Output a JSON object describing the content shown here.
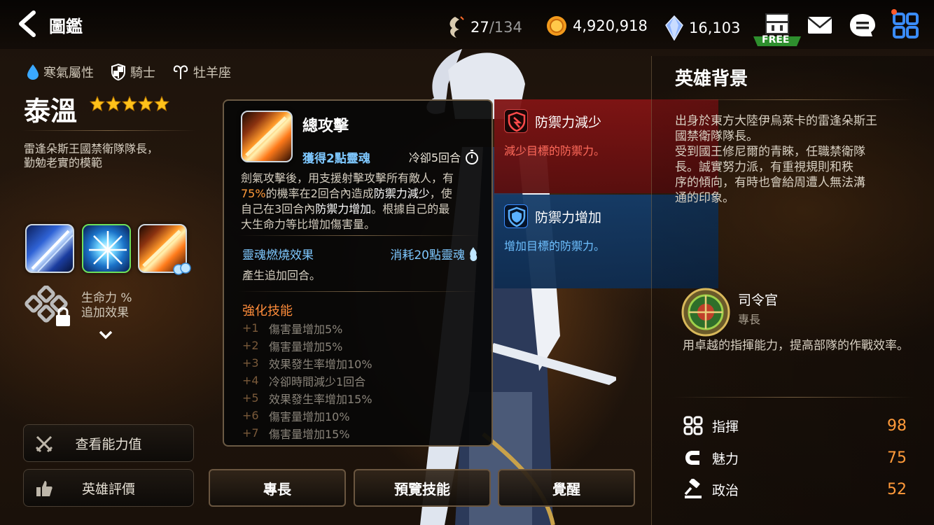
{
  "header": {
    "title": "圖鑑",
    "soul_current": "27",
    "soul_max": "/134",
    "gold": "4,920,918",
    "crystal": "16,103",
    "free_label": "FREE"
  },
  "hero": {
    "element": "寒氣屬性",
    "class": "騎士",
    "zodiac": "牡羊座",
    "name": "泰溫",
    "stars": 5,
    "description_line1": "雷逢朵斯王國禁衛隊隊長，",
    "description_line2": "勤勉老實的模範",
    "locked_bonus_line1": "生命力 %",
    "locked_bonus_line2": "追加效果"
  },
  "left_buttons": {
    "view_stats": "查看能力值",
    "hero_review": "英雄評價"
  },
  "skill_tooltip": {
    "title": "總攻擊",
    "soul_gain": "獲得2點靈魂",
    "cooldown": "冷卻5回合",
    "desc_l1": "劍氣攻擊後，用支援射擊攻擊所有敵人，有",
    "desc_l2_hl": "75%",
    "desc_l2_a": "的機率在2回合內造成",
    "desc_l2_w": "防禦力減少",
    "desc_l2_b": "，使",
    "desc_l3_a": "自己在3回合內",
    "desc_l3_w": "防禦力增加",
    "desc_l3_b": "。根據自己的最",
    "desc_l4": "大生命力等比增加傷害量。",
    "burn_title": "靈魂燃燒效果",
    "burn_cost": "消耗20點靈魂",
    "burn_desc": "產生追加回合。",
    "enhance_title": "強化技能",
    "enhancements": [
      {
        "level": "+1",
        "text": "傷害量增加5%"
      },
      {
        "level": "+2",
        "text": "傷害量增加5%"
      },
      {
        "level": "+3",
        "text": "效果發生率增加10%"
      },
      {
        "level": "+4",
        "text": "冷卻時間減少1回合"
      },
      {
        "level": "+5",
        "text": "效果發生率增加15%"
      },
      {
        "level": "+6",
        "text": "傷害量增加10%"
      },
      {
        "level": "+7",
        "text": "傷害量增加15%"
      }
    ]
  },
  "effects": {
    "debuff_title": "防禦力減少",
    "debuff_desc": "減少目標的防禦力。",
    "buff_title": "防禦力增加",
    "buff_desc": "增加目標的防禦力。"
  },
  "background": {
    "title": "英雄背景",
    "line1": "出身於東方大陸伊烏萊卡的雷逢朵斯王",
    "line2": "國禁衛隊隊長。",
    "line3": "受到國王修尼爾的青睞，任職禁衛隊",
    "line4": "長。誠實努力派，有重視規則和秩",
    "line5": "序的傾向，有時也會給周遭人無法溝",
    "line6": "通的印象。"
  },
  "specialty": {
    "name": "司令官",
    "subtitle": "專長",
    "desc": "用卓越的指揮能力，提高部隊的作戰效率。"
  },
  "stats": [
    {
      "label": "指揮",
      "value": "98"
    },
    {
      "label": "魅力",
      "value": "75"
    },
    {
      "label": "政治",
      "value": "52"
    }
  ],
  "tabs": {
    "specialty": "專長",
    "preview": "預覽技能",
    "awaken": "覺醒"
  },
  "colors": {
    "accent_orange": "#ff9a3a",
    "soul_blue": "#7ec8ff",
    "debuff_red": "#821414",
    "buff_blue": "#143c69"
  }
}
